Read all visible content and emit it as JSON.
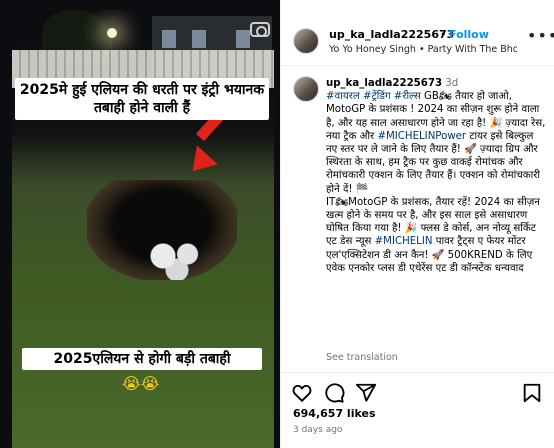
{
  "media": {
    "caption_top": "2025मे हुई एलियन की धरती पर इंट्री भयानक तबाही होने वाली हैं",
    "caption_bottom": "2025एलियन से होगी बड़ी तबाही",
    "caption_emoji": "😭😭"
  },
  "post_header": {
    "username": "up_ka_ladla2225673",
    "dot": "•",
    "follow_label": "Follow",
    "music": "Yo Yo Honey Singh • Party With The Bho..."
  },
  "caption": {
    "username": "up_ka_ladla2225673",
    "time": "3d",
    "text_1": "#वायरल #ट्रेंडिंग #रील्स",
    "text_2": " GB🏍 तैयार हो जाओ, MotoGP के प्रशंसक ! 2024 का सीज़न शुरू होने वाला है, और यह साल असाधारण होने जा रहा है! 🎉 ज़्यादा रेस, नया ट्रैक और ",
    "tag_michelin": "#MICHELINPower",
    "text_3": " टायर इसे बिल्कुल नए स्तर पर ले जाने के लिए तैयार हैं! 🚀 ज़्यादा ग्रिप और स्थिरता के साथ, हम ट्रैक पर कुछ वाकई रोमांचक और रोमांचकारी एक्शन के लिए तैयार हैं। एक्शन को रोमांचकारी होने दें! 🏁",
    "text_4": "IT🏍MotoGP के प्रशंसक, तैयार रहें! 2024 का सीज़न खत्म होने के समय पर है, और इस साल इसे असाधारण घोषित किया गया है! 🎉 फ्लस डे कोर्स, अन नोव्यू सर्किट एट डेस न्यूस ",
    "tag_michelin2": "#MICHELIN",
    "text_5": " पावर ट्रैट्स ए फेयर मोंटर एल'एक्सिटेशन डी अन कैन! 🚀 500KREND के लिए एवेक एनकोर प्लस डी एथेरेंस एट डी कॉन्स्टेंक धन्यवाद",
    "see_translation": "See translation"
  },
  "actions": {
    "likes": "694,657 likes",
    "time_ago": "3 days ago"
  },
  "icons": [
    "camera-icon",
    "more-icon",
    "heart-icon",
    "comment-icon",
    "share-icon",
    "bookmark-icon"
  ]
}
